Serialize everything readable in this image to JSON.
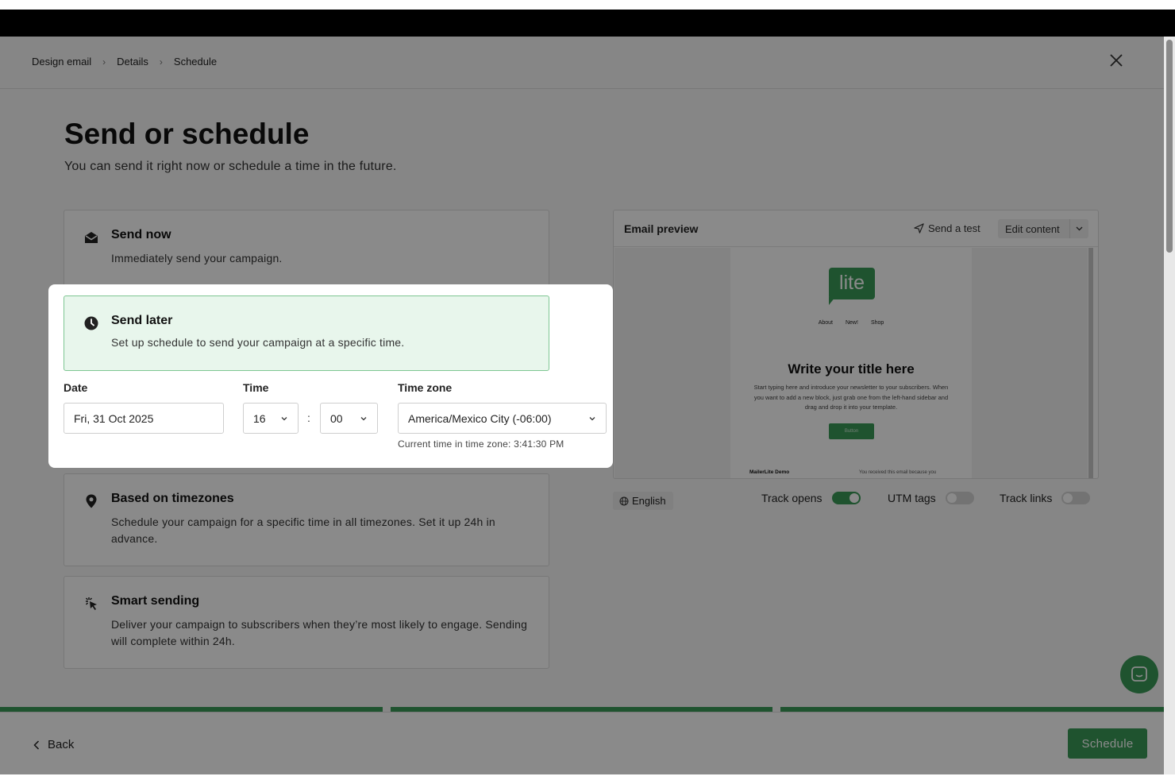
{
  "breadcrumb": {
    "items": [
      "Design email",
      "Details",
      "Schedule"
    ]
  },
  "page": {
    "title": "Send or schedule",
    "subtitle": "You can send it right now or schedule a time in the future."
  },
  "options": {
    "send_now": {
      "title": "Send now",
      "desc": "Immediately send your campaign.",
      "icon": "envelope-open-icon"
    },
    "send_later": {
      "title": "Send later",
      "desc": "Set up schedule to send your campaign at a specific time.",
      "icon": "clock-icon"
    },
    "timezones": {
      "title": "Based on timezones",
      "desc": "Schedule your campaign for a specific time in all timezones. Set it up 24h in advance.",
      "icon": "map-pin-icon"
    },
    "smart": {
      "title": "Smart sending",
      "desc": "Deliver your campaign to subscribers when they’re most likely to engage. Sending will complete within 24h.",
      "icon": "sparkle-cursor-icon"
    }
  },
  "schedule_form": {
    "date_label": "Date",
    "date_value": "Fri, 31 Oct 2025",
    "time_label": "Time",
    "hour": "16",
    "separator": ":",
    "minute": "00",
    "tz_label": "Time zone",
    "tz_value": "America/Mexico City (-06:00)",
    "tz_hint": "Current time in time zone: 3:41:30 PM"
  },
  "preview": {
    "title": "Email preview",
    "send_test": "Send a test",
    "edit_content": "Edit content",
    "email": {
      "logo": "lite",
      "nav": [
        "About",
        "New!",
        "Shop"
      ],
      "heading": "Write your title here",
      "body": "Start typing here and introduce your newsletter to your subscribers. When you want to add a new block, just grab one from the left-hand sidebar and drag and drop it into your template.",
      "button": "Button",
      "footer_sender": "MailerLite Demo",
      "footer_note": "You received this email because you"
    },
    "language": "English",
    "toggles": [
      {
        "label": "Track opens",
        "on": true
      },
      {
        "label": "UTM tags",
        "on": false
      },
      {
        "label": "Track links",
        "on": false
      }
    ]
  },
  "footer": {
    "back": "Back",
    "schedule": "Schedule"
  },
  "colors": {
    "accent": "#3a9a58",
    "selected_bg": "#e8f6ec"
  }
}
